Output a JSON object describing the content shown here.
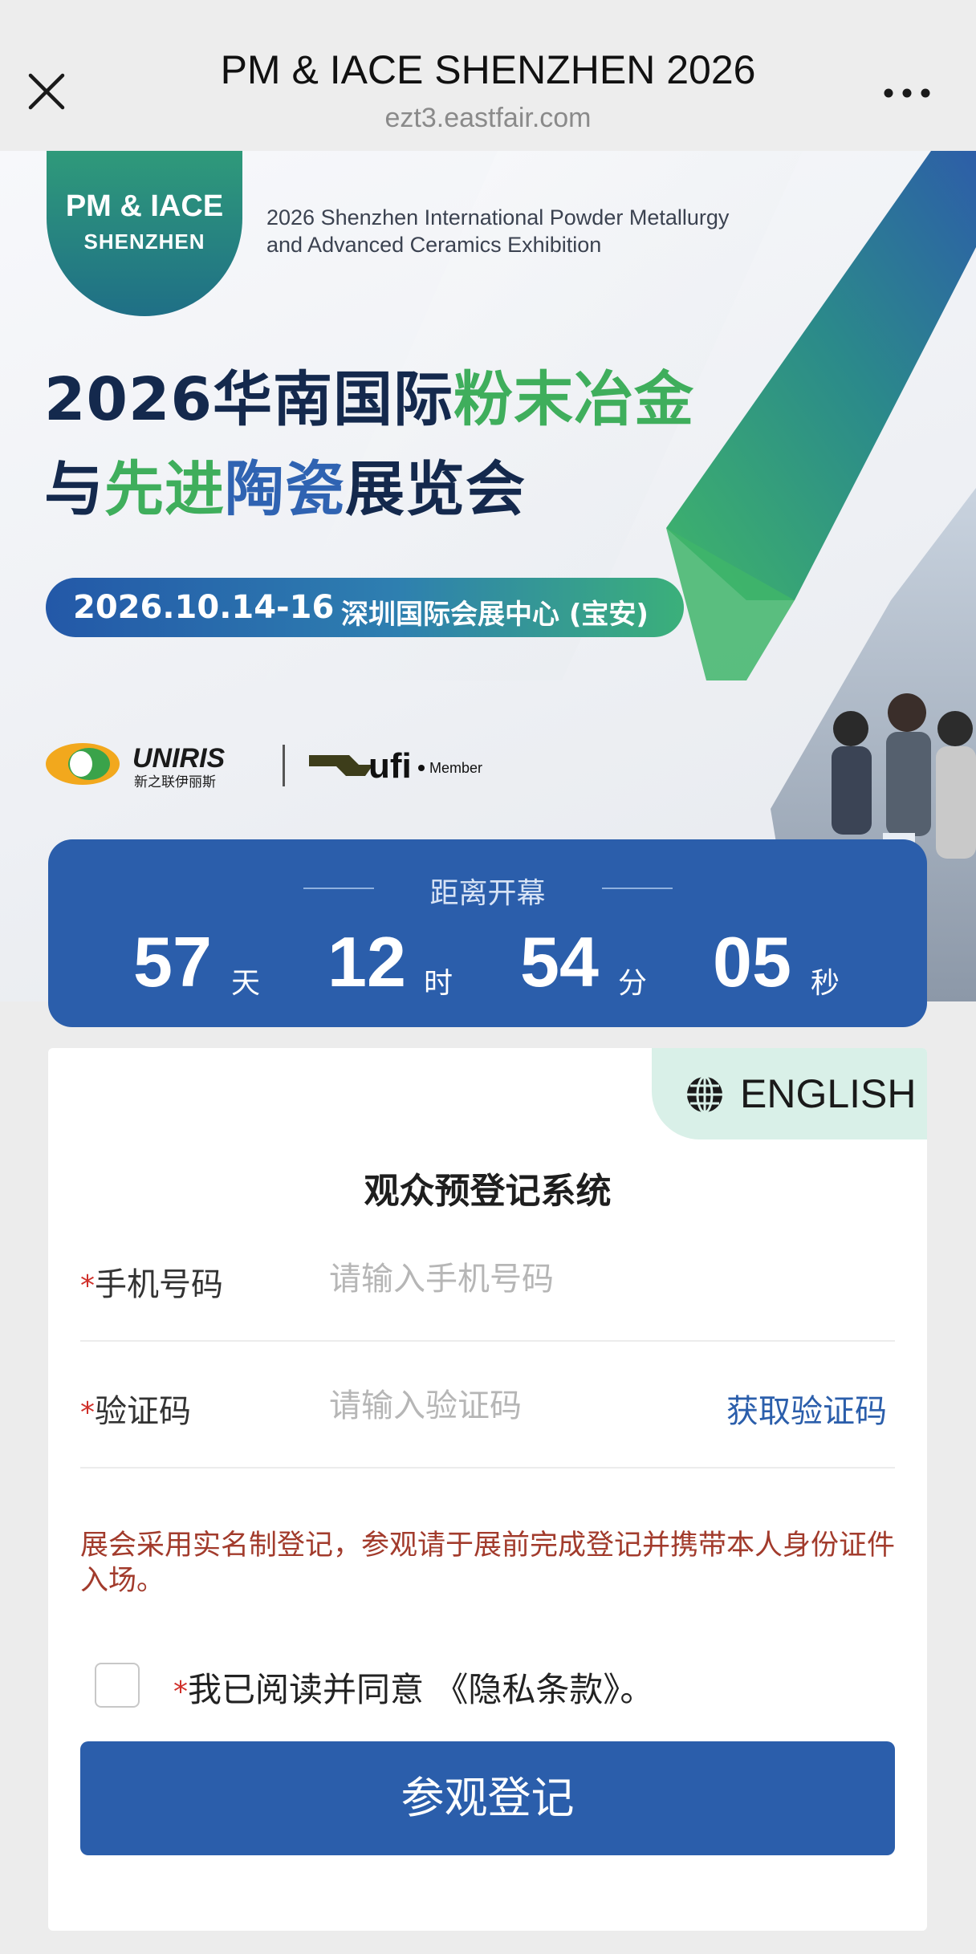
{
  "topbar": {
    "title": "PM & IACE SHENZHEN 2026",
    "url": "ezt3.eastfair.com",
    "close_icon": "close-icon",
    "more_icon": "more-dots-icon"
  },
  "banner": {
    "badge_line1": "PM & IACE",
    "badge_line2": "SHENZHEN",
    "subtitle_en_line1": "2026 Shenzhen International Powder Metallurgy",
    "subtitle_en_line2": "and Advanced Ceramics Exhibition",
    "title_line1_a": "2026华南国际",
    "title_line1_b": "粉末冶金",
    "title_line2_a": "与",
    "title_line2_b": "先进",
    "title_line2_c": "陶瓷",
    "title_line2_d": "展览会",
    "date": "2026.10.14-16",
    "venue": "深圳国际会展中心 (宝安)",
    "logo1_name": "UNIRIS",
    "logo1_sub": "新之联伊丽斯",
    "logo2_name": "ufi",
    "logo2_sub": "Member",
    "colors": {
      "green": "#3fae5c",
      "blue": "#2f63b2",
      "navy": "#14294d"
    }
  },
  "countdown": {
    "label": "距离开幕",
    "days": "57",
    "days_unit": "天",
    "hours": "12",
    "hours_unit": "时",
    "minutes": "54",
    "minutes_unit": "分",
    "seconds": "05",
    "seconds_unit": "秒"
  },
  "form": {
    "language_label": "ENGLISH",
    "language_icon": "globe-icon",
    "title": "观众预登记系统",
    "required_mark": "*",
    "phone_label": "手机号码",
    "phone_placeholder": "请输入手机号码",
    "phone_value": "",
    "code_label": "验证码",
    "code_placeholder": "请输入验证码",
    "code_value": "",
    "get_code": "获取验证码",
    "notice": "展会采用实名制登记，参观请于展前完成登记并携带本人身份证件入场。",
    "agree_text": "我已阅读并同意 《隐私条款》。",
    "agree_checked": false,
    "submit": "参观登记",
    "accent": "#2b5eab"
  }
}
